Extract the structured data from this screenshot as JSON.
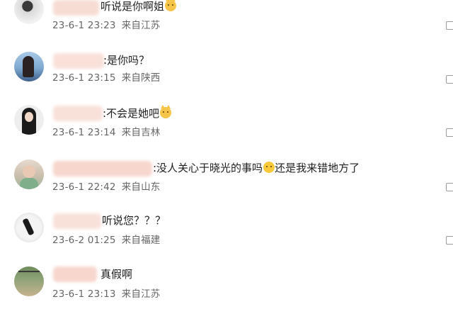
{
  "comments": [
    {
      "text": "听说是你啊姐",
      "date": "23-6-1 23:23",
      "location": "来自江苏"
    },
    {
      "text": ":是你吗？",
      "date": "23-6-1 23:15",
      "location": "来自陕西"
    },
    {
      "text": ":不会是她吧",
      "date": "23-6-1 23:14",
      "location": "来自吉林"
    },
    {
      "text": ":没人关心于晓光的事吗",
      "text2": "还是我来错地方了",
      "date": "23-6-1 22:42",
      "location": "来自山东"
    },
    {
      "text": "听说您？？？",
      "date": "23-6-2 01:25",
      "location": "来自福建"
    },
    {
      "text": "真假啊",
      "date": "23-6-1 23:13",
      "location": "来自江苏"
    }
  ],
  "icons": {
    "emoji_cat": "cat-emoji",
    "emoji_think": "thinking-emoji",
    "action": "reply-icon"
  }
}
